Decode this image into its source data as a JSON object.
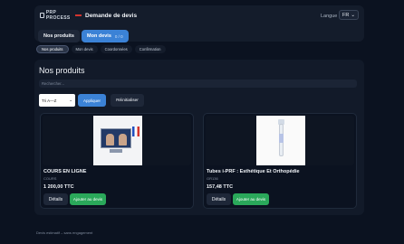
{
  "header": {
    "logo_text": "PRP PROCESS",
    "app_title": "Demande de devis",
    "language_label": "Langue",
    "language_value": "FR",
    "nav": {
      "products_label": "Nos produits",
      "quote_label": "Mon devis",
      "quote_count": "0 / 0"
    }
  },
  "steps": [
    "Nos produits",
    "Mon devis",
    "Coordonnées",
    "Confirmation"
  ],
  "main": {
    "title": "Nos produits",
    "search_placeholder": "Rechercher...",
    "sort_value": "Tri A—Z",
    "apply_label": "Appliquer",
    "reset_label": "Réinitialiser"
  },
  "products": [
    {
      "name": "COURS EN LIGNE",
      "sku": "COURS",
      "price": "1 200,00 TTC",
      "details_label": "Détails",
      "add_label": "Ajouter au devis",
      "image": "online-course-image"
    },
    {
      "name": "Tubes i-PRF : Esthétique Et Orthopédie",
      "sku": "GR136",
      "price": "157,48 TTC",
      "details_label": "Détails",
      "add_label": "Ajouter au devis",
      "image": "tube-image"
    }
  ],
  "footer": {
    "text": "Devis estimatif – sans engagement"
  },
  "colors": {
    "background": "#0b1220",
    "panel": "#121a29",
    "primary": "#3b82d6",
    "success": "#2aa85a",
    "brand_red": "#d3342e"
  }
}
